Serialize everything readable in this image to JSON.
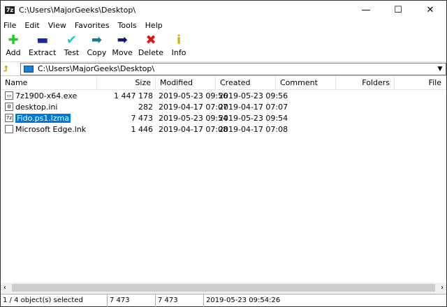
{
  "window": {
    "title": "C:\\Users\\MajorGeeks\\Desktop\\",
    "app_icon": "7z",
    "minimize": "—",
    "maximize": "☐",
    "close": "✕"
  },
  "menu": [
    "File",
    "Edit",
    "View",
    "Favorites",
    "Tools",
    "Help"
  ],
  "toolbar": [
    {
      "label": "Add",
      "icon": "✚",
      "color": "#22cc22"
    },
    {
      "label": "Extract",
      "icon": "▬",
      "color": "#1a2a9c"
    },
    {
      "label": "Test",
      "icon": "✔",
      "color": "#22c8d8"
    },
    {
      "label": "Copy",
      "icon": "➡",
      "color": "#128080"
    },
    {
      "label": "Move",
      "icon": "➡",
      "color": "#0a1a70"
    },
    {
      "label": "Delete",
      "icon": "✖",
      "color": "#dd1111"
    },
    {
      "label": "Info",
      "icon": "i",
      "color": "#d4b000"
    }
  ],
  "address": {
    "path": "C:\\Users\\MajorGeeks\\Desktop\\"
  },
  "columns": [
    "Name",
    "Size",
    "Modified",
    "Created",
    "Comment",
    "Folders",
    "File"
  ],
  "files": [
    {
      "name": "7z1900-x64.exe",
      "size": "1 447 178",
      "modified": "2019-05-23 09:56",
      "created": "2019-05-23 09:56",
      "icon": "▭"
    },
    {
      "name": "desktop.ini",
      "size": "282",
      "modified": "2019-04-17 07:07",
      "created": "2019-04-17 07:07",
      "icon": "⚙"
    },
    {
      "name": "Fido.ps1.lzma",
      "size": "7 473",
      "modified": "2019-05-23 09:54",
      "created": "2019-05-23 09:54",
      "icon": "7z"
    },
    {
      "name": "Microsoft Edge.lnk",
      "size": "1 446",
      "modified": "2019-04-17 07:08",
      "created": "2019-04-17 07:08",
      "icon": ""
    }
  ],
  "scroll": {
    "left": "‹",
    "right": "›"
  },
  "status": {
    "selection": "1 / 4 object(s) selected",
    "size": "7 473",
    "packed": "7 473",
    "date": "2019-05-23 09:54:26"
  }
}
